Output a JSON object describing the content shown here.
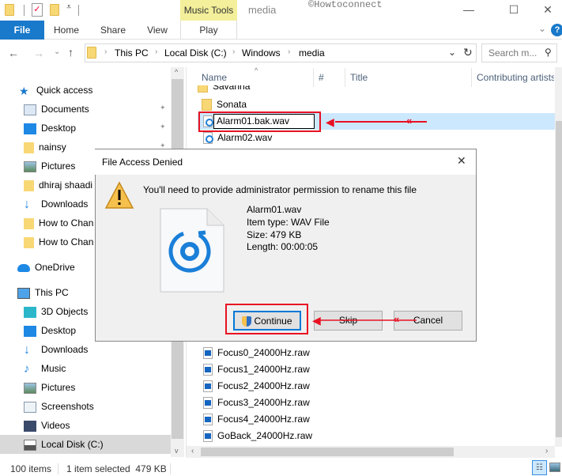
{
  "window": {
    "title": "media",
    "context_tab_group": "Music Tools",
    "watermark": "©Howtoconnect",
    "controls": {
      "minimize": "—",
      "maximize": "☐",
      "close": "✕"
    }
  },
  "ribbon": {
    "tabs": [
      {
        "label": "File",
        "active": true
      },
      {
        "label": "Home"
      },
      {
        "label": "Share"
      },
      {
        "label": "View"
      },
      {
        "label": "Play"
      }
    ],
    "help_label": "?",
    "expand_glyph": "⌄"
  },
  "nav": {
    "back": "←",
    "forward": "→",
    "recent": "⌄",
    "up": "↑",
    "breadcrumb": [
      "This PC",
      "Local Disk (C:)",
      "Windows",
      "media"
    ],
    "breadcrumb_sep": "›",
    "dropdown_glyph": "⌄",
    "refresh_glyph": "↻",
    "search_placeholder": "Search m...",
    "search_glyph": "⚲"
  },
  "sidebar": {
    "quick_access": {
      "label": "Quick access",
      "items": [
        {
          "label": "Documents",
          "icon": "documents-icon",
          "pinned": true
        },
        {
          "label": "Desktop",
          "icon": "desktop-icon",
          "pinned": true
        },
        {
          "label": "nainsy",
          "icon": "folder-icon",
          "pinned": true
        },
        {
          "label": "Pictures",
          "icon": "pictures-icon"
        },
        {
          "label": "dhiraj shaadi",
          "icon": "folder-icon"
        },
        {
          "label": "Downloads",
          "icon": "downloads-icon"
        },
        {
          "label": "How to Chan",
          "icon": "folder-icon"
        },
        {
          "label": "How to Chan",
          "icon": "folder-icon"
        }
      ]
    },
    "onedrive": {
      "label": "OneDrive"
    },
    "this_pc": {
      "label": "This PC",
      "items": [
        {
          "label": "3D Objects",
          "icon": "3d-objects-icon"
        },
        {
          "label": "Desktop",
          "icon": "desktop-icon"
        },
        {
          "label": "Downloads",
          "icon": "downloads-icon"
        },
        {
          "label": "Music",
          "icon": "music-icon"
        },
        {
          "label": "Pictures",
          "icon": "pictures-icon"
        },
        {
          "label": "Screenshots",
          "icon": "screenshots-icon"
        },
        {
          "label": "Videos",
          "icon": "videos-icon"
        },
        {
          "label": "Local Disk (C:)",
          "icon": "local-disk-icon",
          "selected": true
        }
      ]
    },
    "pin_glyph": "📌"
  },
  "file_list": {
    "columns": [
      "Name",
      "#",
      "Title",
      "Contributing artists"
    ],
    "sort_glyph": "^",
    "rows_top": [
      {
        "name": "Savanna",
        "type": "folder"
      },
      {
        "name": "Sonata",
        "type": "folder"
      },
      {
        "name": "Alarm01.bak.wav",
        "type": "wav",
        "selected": true,
        "renaming": true
      },
      {
        "name": "Alarm02.wav",
        "type": "wav"
      }
    ],
    "rows_bottom": [
      {
        "name": "Focus0_24000Hz.raw",
        "type": "raw"
      },
      {
        "name": "Focus1_24000Hz.raw",
        "type": "raw"
      },
      {
        "name": "Focus2_24000Hz.raw",
        "type": "raw"
      },
      {
        "name": "Focus3_24000Hz.raw",
        "type": "raw"
      },
      {
        "name": "Focus4_24000Hz.raw",
        "type": "raw"
      },
      {
        "name": "GoBack_24000Hz.raw",
        "type": "raw"
      }
    ]
  },
  "dialog": {
    "title": "File Access Denied",
    "close_glyph": "✕",
    "message": "You'll need to provide administrator permission to rename this file",
    "file": {
      "name": "Alarm01.wav",
      "type": "Item type: WAV File",
      "size": "Size: 479 KB",
      "length": "Length: 00:00:05"
    },
    "buttons": {
      "continue": "Continue",
      "skip": "Skip",
      "cancel": "Cancel"
    }
  },
  "status": {
    "item_count": "100 items",
    "selection": "1 item selected  479 KB"
  },
  "annotations": {
    "color": "#e81123"
  }
}
